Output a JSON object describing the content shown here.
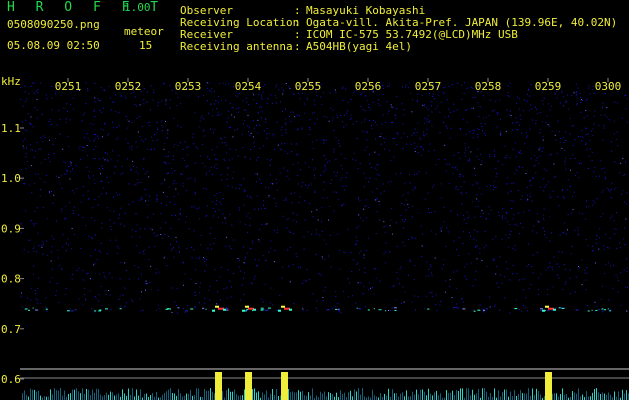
{
  "header": {
    "app_title": "H R O F F T",
    "version": "1.00",
    "filename": "0508090250.png",
    "datetime": "05.08.09 02:50",
    "meteor_label": "meteor",
    "meteor_count": "15"
  },
  "info": [
    {
      "label": "Observer",
      "value": "Masayuki Kobayashi"
    },
    {
      "label": "Receiving Location",
      "value": "Ogata-vill. Akita-Pref. JAPAN (139.96E, 40.02N)"
    },
    {
      "label": "Receiver",
      "value": "ICOM IC-575 53.7492(@LCD)MHz USB"
    },
    {
      "label": "Receiving antenna",
      "value": "A504HB(yagi 4el)"
    }
  ],
  "colon": ":",
  "chart_data": {
    "type": "heatmap",
    "y_unit_label": "kHz",
    "time_labels": [
      "0251",
      "0252",
      "0253",
      "0254",
      "0255",
      "0256",
      "0257",
      "0258",
      "0259",
      "0300"
    ],
    "freq_labels": [
      "1.1",
      "1.0",
      "0.9",
      "0.8",
      "0.7",
      "0.6"
    ],
    "freq_values": [
      1.1,
      1.0,
      0.9,
      0.8,
      0.7,
      0.6
    ],
    "time_range": [
      "0250",
      "0300"
    ],
    "freq_range_khz": [
      0.58,
      1.2
    ],
    "meteor_echo_freq_khz": 0.74,
    "strong_echo_times": [
      "0253.5",
      "0254",
      "0254.6",
      "0259"
    ],
    "colors": {
      "background": "#000000",
      "noise": "#2222cc",
      "echo_hot": "#ff3333",
      "echo_mid": "#ffff44",
      "echo_low": "#33ffcc",
      "tick_text": "#f0ee3a",
      "baseline": "#cccccc",
      "level_bars": "#f0ee3a"
    }
  }
}
